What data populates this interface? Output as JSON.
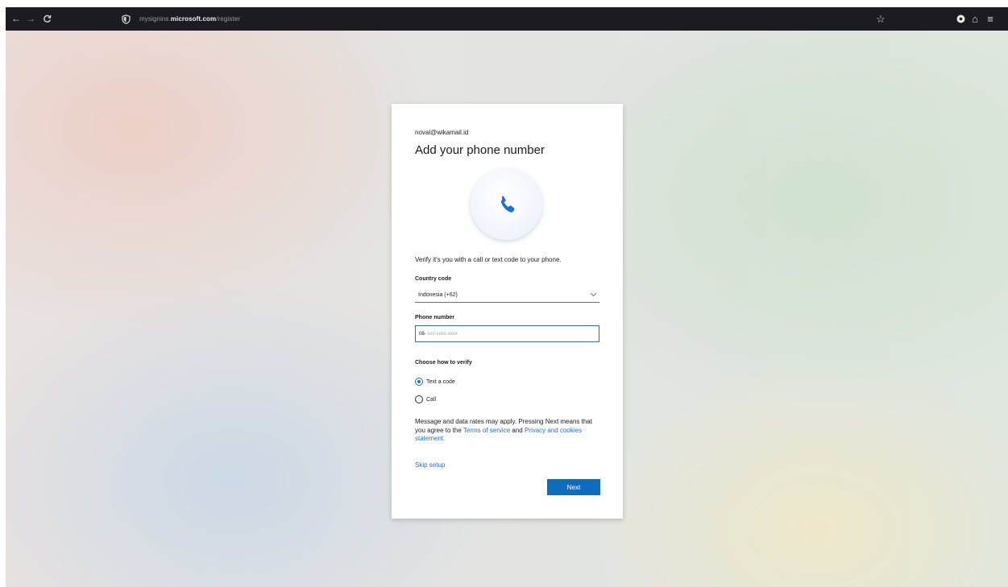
{
  "browser": {
    "url_prefix": "mysignins.",
    "url_domain": "microsoft.com",
    "url_path": "/register",
    "nav_back": "←",
    "nav_forward": "→",
    "nav_reload": "C",
    "bookmark": "☆",
    "home": "⌂",
    "menu": "≡"
  },
  "card": {
    "email": "noval@wikamail.id",
    "title": "Add your phone number",
    "description": "Verify it's you with a call or text code to your phone.",
    "country_label": "Country code",
    "country_value": "Indonesia (+62)",
    "phone_label": "Phone number",
    "phone_prefix": "08-",
    "phone_placeholder": "xxx-xxxx-xxxx",
    "verify_label": "Choose how to verify",
    "options": [
      {
        "label": "Text a code",
        "selected": true
      },
      {
        "label": "Call",
        "selected": false
      }
    ],
    "disclaimer_before": "Message and data rates may apply. Pressing Next means that you agree to the ",
    "terms_link": "Terms of service",
    "disclaimer_and": " and ",
    "privacy_link": "Privacy and cookies statement.",
    "skip_label": "Skip setup",
    "next_label": "Next"
  },
  "colors": {
    "accent": "#0f6cbd",
    "toolbar": "#1c1b22"
  },
  "icons": {
    "phone": "phone-icon",
    "shield": "shield-icon",
    "chevron": "chevron-down-icon"
  }
}
